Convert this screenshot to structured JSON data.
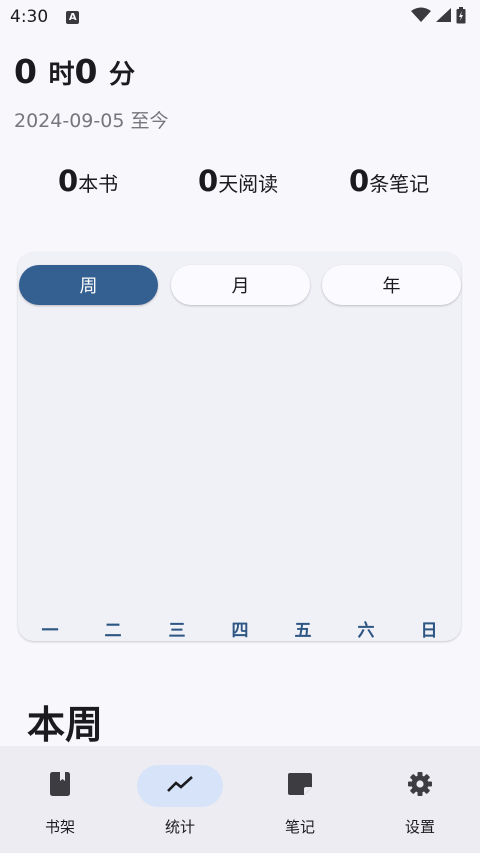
{
  "status_bar": {
    "time": "4:30",
    "notification_icon": "a-icon",
    "icons": [
      "wifi-icon",
      "signal-icon",
      "battery-icon"
    ]
  },
  "summary": {
    "hours": "0",
    "hours_unit": "时",
    "minutes": "0",
    "minutes_unit": "分",
    "since": "2024-09-05 至今"
  },
  "stats": [
    {
      "value": "0",
      "label": "本书"
    },
    {
      "value": "0",
      "label": "天阅读"
    },
    {
      "value": "0",
      "label": "条笔记"
    }
  ],
  "chart": {
    "tabs": [
      {
        "label": "周",
        "selected": true
      },
      {
        "label": "月",
        "selected": false
      },
      {
        "label": "年",
        "selected": false
      }
    ],
    "days": [
      "一",
      "二",
      "三",
      "四",
      "五",
      "六",
      "日"
    ],
    "accent_color": "#345f91"
  },
  "section": {
    "title": "本周"
  },
  "bottom_nav": [
    {
      "label": "书架",
      "icon": "bookshelf-icon",
      "selected": false
    },
    {
      "label": "统计",
      "icon": "trending-icon",
      "selected": true
    },
    {
      "label": "笔记",
      "icon": "note-icon",
      "selected": false
    },
    {
      "label": "设置",
      "icon": "gear-icon",
      "selected": false
    }
  ]
}
